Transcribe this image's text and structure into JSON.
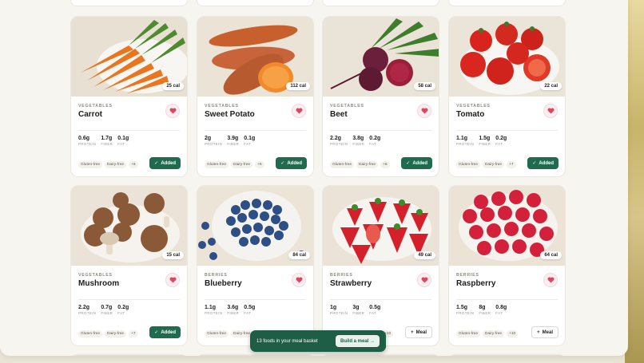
{
  "basket": {
    "text": "13 foods in your meal basket",
    "button": "Build a meal →"
  },
  "cards": [
    {
      "category": "VEGETABLES",
      "name": "Carrot",
      "cal": "25 cal",
      "protein": "0.6g",
      "fiber": "1.7g",
      "fat": "0.1g",
      "tags": [
        "Gluten-free",
        "Dairy-free",
        "+6"
      ],
      "action": "Added",
      "added": true
    },
    {
      "category": "VEGETABLES",
      "name": "Sweet Potato",
      "cal": "112 cal",
      "protein": "2g",
      "fiber": "3.9g",
      "fat": "0.1g",
      "tags": [
        "Gluten-free",
        "Dairy-free",
        "+6"
      ],
      "action": "Added",
      "added": true
    },
    {
      "category": "VEGETABLES",
      "name": "Beet",
      "cal": "58 cal",
      "protein": "2.2g",
      "fiber": "3.8g",
      "fat": "0.2g",
      "tags": [
        "Gluten-free",
        "Dairy-free",
        "+6"
      ],
      "action": "Added",
      "added": true
    },
    {
      "category": "VEGETABLES",
      "name": "Tomato",
      "cal": "22 cal",
      "protein": "1.1g",
      "fiber": "1.5g",
      "fat": "0.2g",
      "tags": [
        "Gluten-free",
        "Dairy-free",
        "+7"
      ],
      "action": "Added",
      "added": true
    },
    {
      "category": "VEGETABLES",
      "name": "Mushroom",
      "cal": "15 cal",
      "protein": "2.2g",
      "fiber": "0.7g",
      "fat": "0.2g",
      "tags": [
        "Gluten-free",
        "Dairy-free",
        "+7"
      ],
      "action": "Added",
      "added": true
    },
    {
      "category": "BERRIES",
      "name": "Blueberry",
      "cal": "84 cal",
      "protein": "1.1g",
      "fiber": "3.6g",
      "fat": "0.5g",
      "tags": [
        "Gluten-free",
        "Dairy-free"
      ],
      "action": "",
      "added": false
    },
    {
      "category": "BERRIES",
      "name": "Strawberry",
      "cal": "49 cal",
      "protein": "1g",
      "fiber": "3g",
      "fat": "0.5g",
      "tags": [
        "+10"
      ],
      "action": "Meal",
      "added": false
    },
    {
      "category": "BERRIES",
      "name": "Raspberry",
      "cal": "64 cal",
      "protein": "1.5g",
      "fiber": "8g",
      "fat": "0.8g",
      "tags": [
        "Gluten-free",
        "Dairy-free",
        "+10"
      ],
      "action": "Meal",
      "added": false
    }
  ],
  "macro_labels": {
    "protein": "PROTEIN",
    "fiber": "FIBER",
    "fat": "FAT"
  },
  "colors": {
    "accent": "#1f6b4f",
    "heart": "#d9485f",
    "bar": "#1e5e47"
  }
}
